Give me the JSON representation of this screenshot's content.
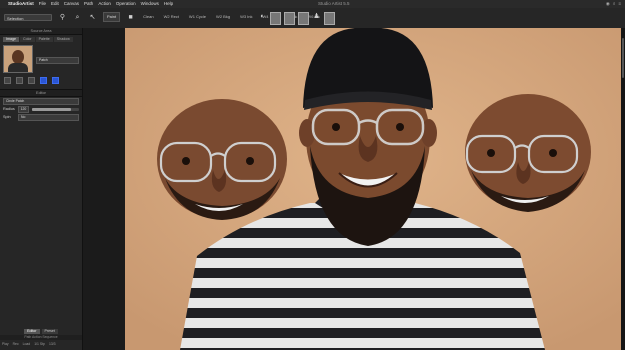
{
  "menubar": {
    "app_name": "StudioArtist",
    "items": [
      "File",
      "Edit",
      "Canvas",
      "Path",
      "Action",
      "Operation",
      "Windows",
      "Help"
    ],
    "window_title": "Studio Artist 5.5"
  },
  "toolbar": {
    "tool_select": "Selection",
    "brush_button": "Paint",
    "chips": [
      "Clean",
      "W2 Rect",
      "W1 Cycle",
      "W2 Bkg",
      "W3 Ink",
      "W4 Ink",
      "W5 Ink",
      "W6 Ink"
    ]
  },
  "left_panel": {
    "title": "Source Area",
    "tabs": [
      "Image",
      "Color",
      "Palette",
      "Shadow"
    ],
    "active_tab": "Image",
    "preset_select": "Patch",
    "editor_title": "Editor",
    "editor_dropdown": "Circle Patch",
    "radius_label": "Radius",
    "radius_value": "120",
    "radius_fraction": 0.82,
    "spin_label": "Spin",
    "spin_value": "No",
    "bottom_tabs": [
      "Editor",
      "Preset"
    ],
    "active_bottom_tab": "Editor",
    "bottom_info": "Path Action Sequence",
    "status": [
      "Play",
      "Rec",
      "Load",
      "1/1 Stp",
      "13/3"
    ]
  },
  "colors": {
    "accent": "#2a55d4",
    "background": "#d4a67e"
  }
}
